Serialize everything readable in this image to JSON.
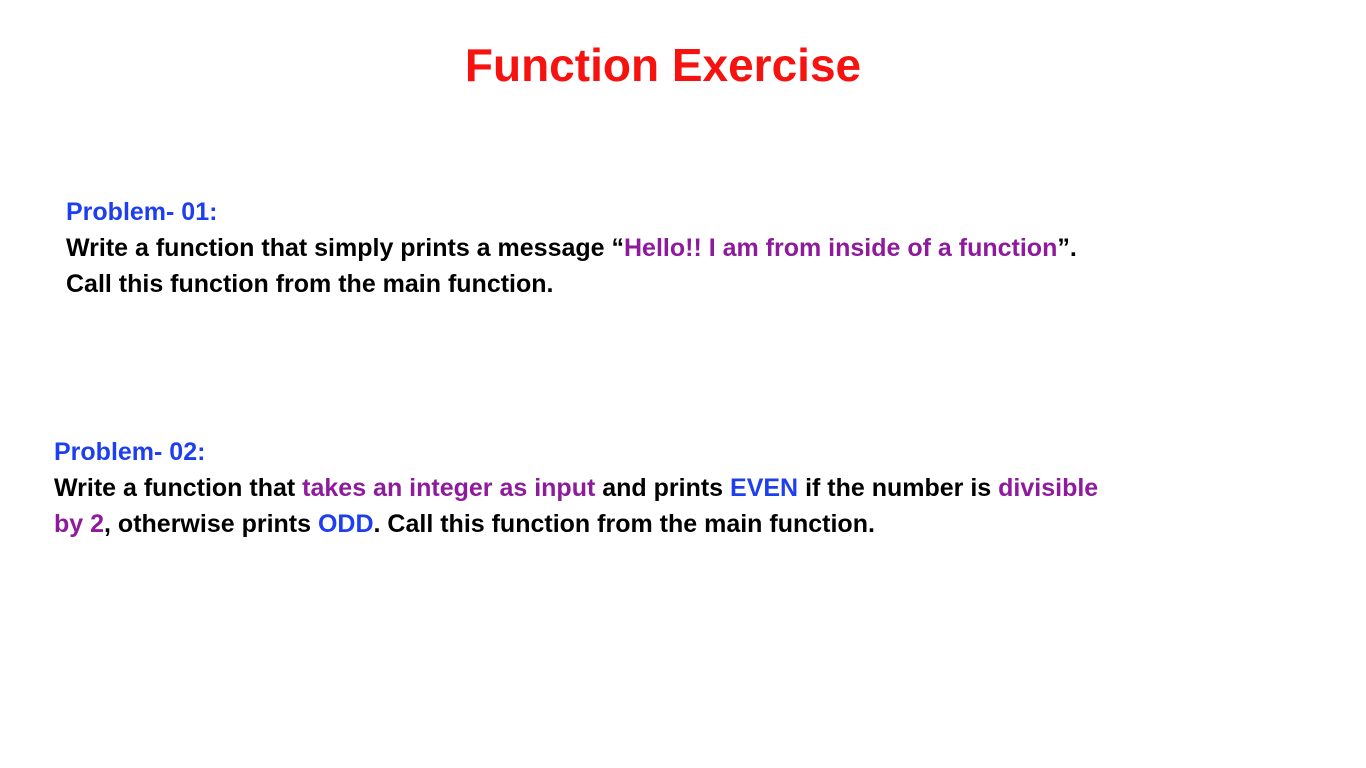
{
  "colors": {
    "title": "#f5120f",
    "heading": "#1d3ff0",
    "highlight": "#8e1a9c",
    "keyword": "#1d3ff0",
    "body": "#000000"
  },
  "title": "Function Exercise",
  "problems": [
    {
      "heading": "Problem- 01:",
      "line1": {
        "before": "Write a function that simply prints a message “",
        "highlight": "Hello!! I am from inside of  a function",
        "after": "”."
      },
      "line2": "Call this function from the main function."
    },
    {
      "heading": "Problem- 02:",
      "line1": {
        "t1": "Write a function that ",
        "h1": "takes an integer as input",
        "t2": " and prints ",
        "k1": "EVEN",
        "t3": " if the number is ",
        "h2": "divisible"
      },
      "line2": {
        "h3": "by 2",
        "t4": ", otherwise prints ",
        "k2": "ODD",
        "t5": ". Call this function from the main function."
      }
    }
  ]
}
